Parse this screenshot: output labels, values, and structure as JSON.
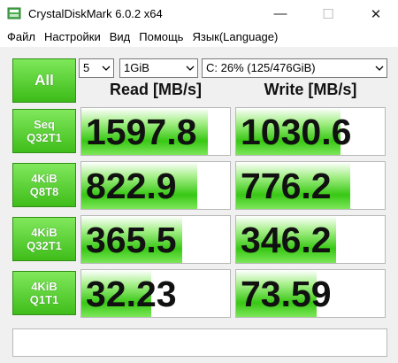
{
  "window": {
    "title": "CrystalDiskMark 6.0.2 x64",
    "minimize": "—",
    "maximize": "☐",
    "close": "✕"
  },
  "menu": [
    "Файл",
    "Настройки",
    "Вид",
    "Помощь",
    "Язык(Language)"
  ],
  "controls": {
    "all_label": "All",
    "count": "5",
    "size": "1GiB",
    "drive": "C: 26% (125/476GiB)"
  },
  "headers": {
    "read": "Read [MB/s]",
    "write": "Write [MB/s]"
  },
  "tests": [
    {
      "line1": "Seq",
      "line2": "Q32T1",
      "read": "1597.8",
      "write": "1030.6",
      "read_fill": 0.85,
      "write_fill": 0.7
    },
    {
      "line1": "4KiB",
      "line2": "Q8T8",
      "read": "822.9",
      "write": "776.2",
      "read_fill": 0.78,
      "write_fill": 0.77
    },
    {
      "line1": "4KiB",
      "line2": "Q32T1",
      "read": "365.5",
      "write": "346.2",
      "read_fill": 0.68,
      "write_fill": 0.67
    },
    {
      "line1": "4KiB",
      "line2": "Q1T1",
      "read": "32.23",
      "write": "73.59",
      "read_fill": 0.47,
      "write_fill": 0.54
    }
  ],
  "comment": "",
  "colors": {
    "accent_green": "#3cbb18",
    "bar_green": "#38c814"
  }
}
